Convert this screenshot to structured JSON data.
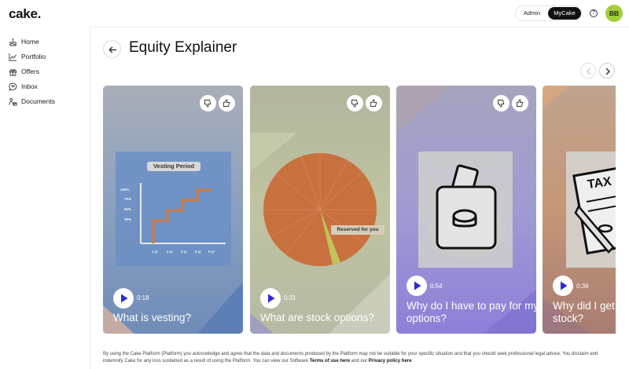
{
  "app": {
    "logo_text": "cake.",
    "avatar_initials": "BB",
    "avatar_color": "#a3cf3d",
    "role_toggle": {
      "admin_label": "Admin",
      "mycake_label": "MyCake",
      "selected": "MyCake"
    },
    "help_icon": "question-circle-icon"
  },
  "sidebar": {
    "items": [
      {
        "label": "Home",
        "icon": "cake-icon"
      },
      {
        "label": "Portfolio",
        "icon": "trend-chart-icon"
      },
      {
        "label": "Offers",
        "icon": "gift-icon"
      },
      {
        "label": "Inbox",
        "icon": "chat-bubble-icon"
      },
      {
        "label": "Documents",
        "icon": "person-docs-icon"
      }
    ]
  },
  "main": {
    "title": "Equity Explainer",
    "back_icon": "arrow-left-icon",
    "prev_icon": "chevron-left-icon",
    "next_icon": "chevron-right-icon",
    "cards": [
      {
        "title": "What is vesting?",
        "duration": "0:18",
        "illustration": {
          "heading": "Vesting Period",
          "y_ticks": [
            "100%",
            "75%",
            "50%",
            "25%"
          ],
          "x_ticks": [
            "1 yr",
            "2 yr",
            "3 yr",
            "4 yr",
            "5 yr"
          ]
        }
      },
      {
        "title": "What are stock options?",
        "duration": "0:31",
        "illustration": {
          "label": "Reserved for you"
        }
      },
      {
        "title": "Why do I have to pay for my options?",
        "duration": "0:54",
        "illustration": {}
      },
      {
        "title": "Why did I get taxed and not stock?",
        "duration": "0:36",
        "illustration": {
          "label": "TAX"
        }
      }
    ]
  },
  "footer": {
    "text_1": "By using the Cake Platform (Platform) you acknowledge and agree that the data and documents produced by the Platform may not be suitable for your specific situation and that you should seek professional legal advice. You disclaim and indemnify Cake for any loss sustained as a result of using the Platform. You can view our Software ",
    "terms_link": "Terms of use here",
    "text_2": " and our ",
    "privacy_link": "Privacy policy here",
    "text_3": "."
  }
}
